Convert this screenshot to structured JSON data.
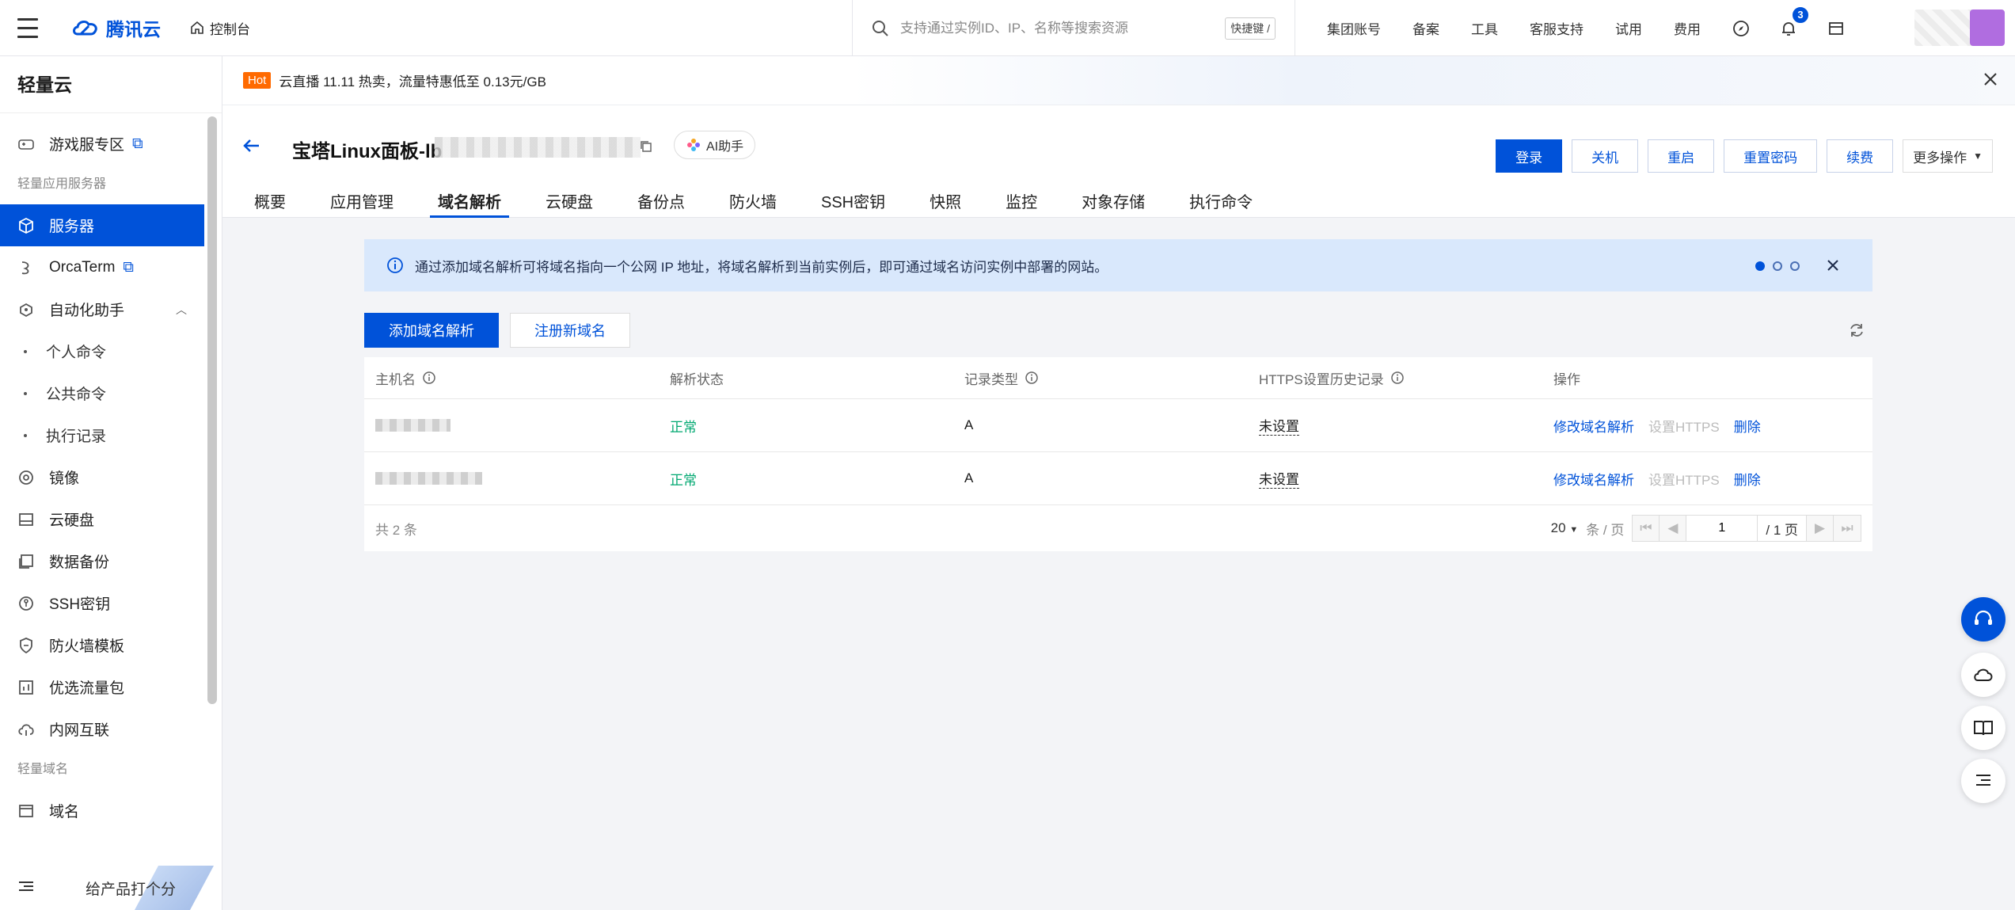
{
  "topbar": {
    "brand": "腾讯云",
    "console": "控制台",
    "search_placeholder": "支持通过实例ID、IP、名称等搜索资源",
    "shortcut": "快捷键 /",
    "nav": [
      "集团账号",
      "备案",
      "工具",
      "客服支持",
      "试用",
      "费用"
    ],
    "notif_count": "3"
  },
  "sidebar": {
    "title": "轻量云",
    "game": "游戏服专区",
    "group1": "轻量应用服务器",
    "server": "服务器",
    "orcaterm": "OrcaTerm",
    "automation": "自动化助手",
    "subs": [
      "个人命令",
      "公共命令",
      "执行记录"
    ],
    "items": [
      "镜像",
      "云硬盘",
      "数据备份",
      "SSH密钥",
      "防火墙模板",
      "优选流量包",
      "内网互联"
    ],
    "group2": "轻量域名",
    "domain": "域名",
    "rate": "给产品打个分"
  },
  "banner": {
    "tag": "Hot",
    "text": "云直播 11.11 热卖，流量特惠低至 0.13元/GB"
  },
  "header": {
    "title": "宝塔Linux面板-lb",
    "ai": "AI助手",
    "actions": [
      "登录",
      "关机",
      "重启",
      "重置密码",
      "续费"
    ],
    "more": "更多操作",
    "tabs": [
      "概要",
      "应用管理",
      "域名解析",
      "云硬盘",
      "备份点",
      "防火墙",
      "SSH密钥",
      "快照",
      "监控",
      "对象存储",
      "执行命令"
    ],
    "active_tab": "域名解析"
  },
  "notice": {
    "text": "通过添加域名解析可将域名指向一个公网 IP 地址，将域名解析到当前实例后，即可通过域名访问实例中部署的网站。"
  },
  "toolbar": {
    "add": "添加域名解析",
    "register": "注册新域名"
  },
  "table": {
    "columns": [
      "主机名",
      "解析状态",
      "记录类型",
      "HTTPS设置历史记录",
      "操作"
    ],
    "rows": [
      {
        "status": "正常",
        "type": "A",
        "https": "未设置",
        "op_edit": "修改域名解析",
        "op_https": "设置HTTPS",
        "op_delete": "删除"
      },
      {
        "status": "正常",
        "type": "A",
        "https": "未设置",
        "op_edit": "修改域名解析",
        "op_https": "设置HTTPS",
        "op_delete": "删除"
      }
    ],
    "total": "共 2 条",
    "page_size": "20",
    "per_page": "条 / 页",
    "page": "1",
    "page_total": "/ 1 页"
  },
  "colors": {
    "accent": "#0052d9",
    "ok": "#00a870",
    "hot": "#ff6a00"
  }
}
